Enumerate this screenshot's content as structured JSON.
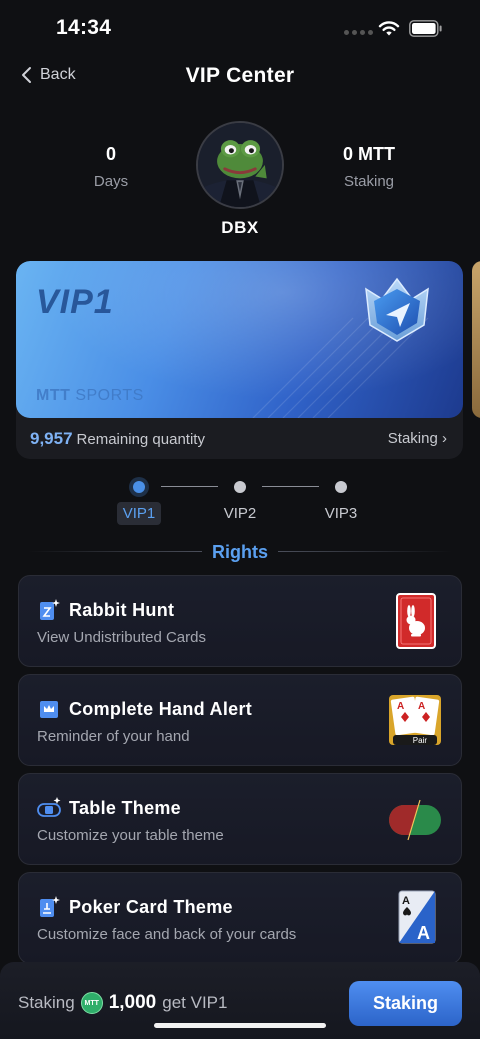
{
  "status_bar": {
    "time": "14:34",
    "icons": [
      "signal-dots-icon",
      "wifi-icon",
      "battery-icon"
    ]
  },
  "nav": {
    "back_label": "Back",
    "title": "VIP Center"
  },
  "profile": {
    "days_value": "0",
    "days_label": "Days",
    "staking_value": "0 MTT",
    "staking_label": "Staking",
    "username": "DBX"
  },
  "vip_card": {
    "level_title": "VIP1",
    "brand_bold": "MTT",
    "brand_light": "SPORTS",
    "remaining_value": "9,957",
    "remaining_label": "Remaining quantity",
    "staking_link": "Staking ›"
  },
  "levels": [
    {
      "label": "VIP1",
      "active": true
    },
    {
      "label": "VIP2",
      "active": false
    },
    {
      "label": "VIP3",
      "active": false
    }
  ],
  "rights": {
    "title": "Rights",
    "items": [
      {
        "title": "Rabbit Hunt",
        "subtitle": "View Undistributed Cards",
        "icon": "card-star-icon",
        "art": "rabbit-card-icon"
      },
      {
        "title": "Complete Hand Alert",
        "subtitle": "Reminder of your hand",
        "icon": "card-crown-icon",
        "art": "pair-cards-icon",
        "art_label": "Pair"
      },
      {
        "title": "Table Theme",
        "subtitle": "Customize your table theme",
        "icon": "table-theme-icon",
        "art": "table-colors-icon"
      },
      {
        "title": "Poker Card Theme",
        "subtitle": "Customize face and back of your cards",
        "icon": "card-brush-icon",
        "art": "ace-spade-card-icon"
      }
    ]
  },
  "bottom_bar": {
    "prefix": "Staking",
    "coin_label": "MTT",
    "amount": "1,000",
    "suffix": "get VIP1",
    "button_label": "Staking"
  },
  "colors": {
    "background": "#0f1013",
    "accent_blue": "#5ba0f0",
    "button_blue": "#3d78df",
    "card_bg": "#1b1e2b"
  }
}
